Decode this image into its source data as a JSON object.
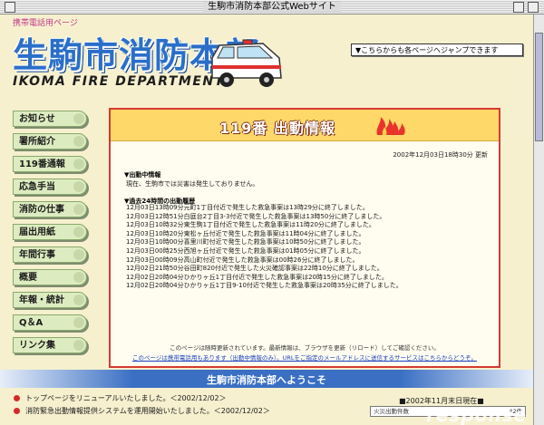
{
  "window": {
    "title": "生駒市消防本部公式Webサイト"
  },
  "header": {
    "mobile_link": "携帯電話用ページ",
    "logo_text": "生駒市消防本部",
    "logo_en": "IKOMA FIRE DEPARTMENT",
    "jump_select": "▼こちらからも各ページへジャンプできます"
  },
  "sidebar": {
    "items": [
      {
        "label": "お知らせ"
      },
      {
        "label": "署所紹介"
      },
      {
        "label": "119番通報"
      },
      {
        "label": "応急手当"
      },
      {
        "label": "消防の仕事"
      },
      {
        "label": "届出用紙"
      },
      {
        "label": "年間行事"
      },
      {
        "label": "概要"
      },
      {
        "label": "年報・統計"
      },
      {
        "label": "Q＆A"
      },
      {
        "label": "リンク集"
      }
    ]
  },
  "panel": {
    "title": "119番 出動情報",
    "timestamp": "2002年12月03日18時30分 更新",
    "current_heading": "▼出動中情報",
    "current_status": "現在、生駒市では災害は発生しておりません。",
    "history_heading": "▼過去24時間の出動履歴",
    "history": [
      "12月03日13時09分元町1丁目付近で発生した救急事案は13時29分に終了しました。",
      "12月03日12時51分白庭台2丁目3-3付近で発生した救急事案は13時50分に終了しました。",
      "12月03日10時32分東生駒1丁目付近で発生した救急事案は11時20分に終了しました。",
      "12月03日10時20分東松ヶ丘付近で発生した救急事案は11時04分に終了しました。",
      "12月03日10時00分喜里川町付近で発生した救急事案は10時50分に終了しました。",
      "12月03日00時25分西旭ヶ丘付近で発生した救急事案は01時05分に終了しました。",
      "12月03日00時09分高山町付近で発生した救急事案は00時26分に終了しました。",
      "12月02日21時50分谷田町820付近で発生した火災確認事案は22時10分に終了しました。",
      "12月02日20時04分ひかりヶ丘1丁目付近で発生した救急事案は20時15分に終了しました。",
      "12月02日20時04分ひかりヶ丘1丁目9-10付近で発生した救急事案は20時35分に終了しました。"
    ],
    "note1": "このページは随時更新されています。最新情報は、ブラウザを更新（リロード）してご確認ください。",
    "note2": "このページは携帯電話用もあります（出動中情報のみ）。URLをご指定のメールアドレスに送信するサービスはこちらからどうぞ。"
  },
  "welcome": {
    "text": "生駒市消防本部へようこそ"
  },
  "news": [
    "トップページをリニューアルいたしました。＜2002/12/02＞",
    "消防緊急出動情報提供システムを運用開始いたしました。＜2002/12/02＞"
  ],
  "count": {
    "title": "■2002年11月末日現在■",
    "row_label": "火災出動件数",
    "row_value": "42件"
  },
  "watermark": "response",
  "colors": {
    "page_bg": "#f6f0cf",
    "logo_blue": "#2a6fc9",
    "panel_border": "#d53b2f",
    "banner_yellow": "#ffd86a",
    "nav_green": "#ddecc0",
    "welcome_blue": "#3a6fc4",
    "link_blue": "#1a3fbf"
  }
}
